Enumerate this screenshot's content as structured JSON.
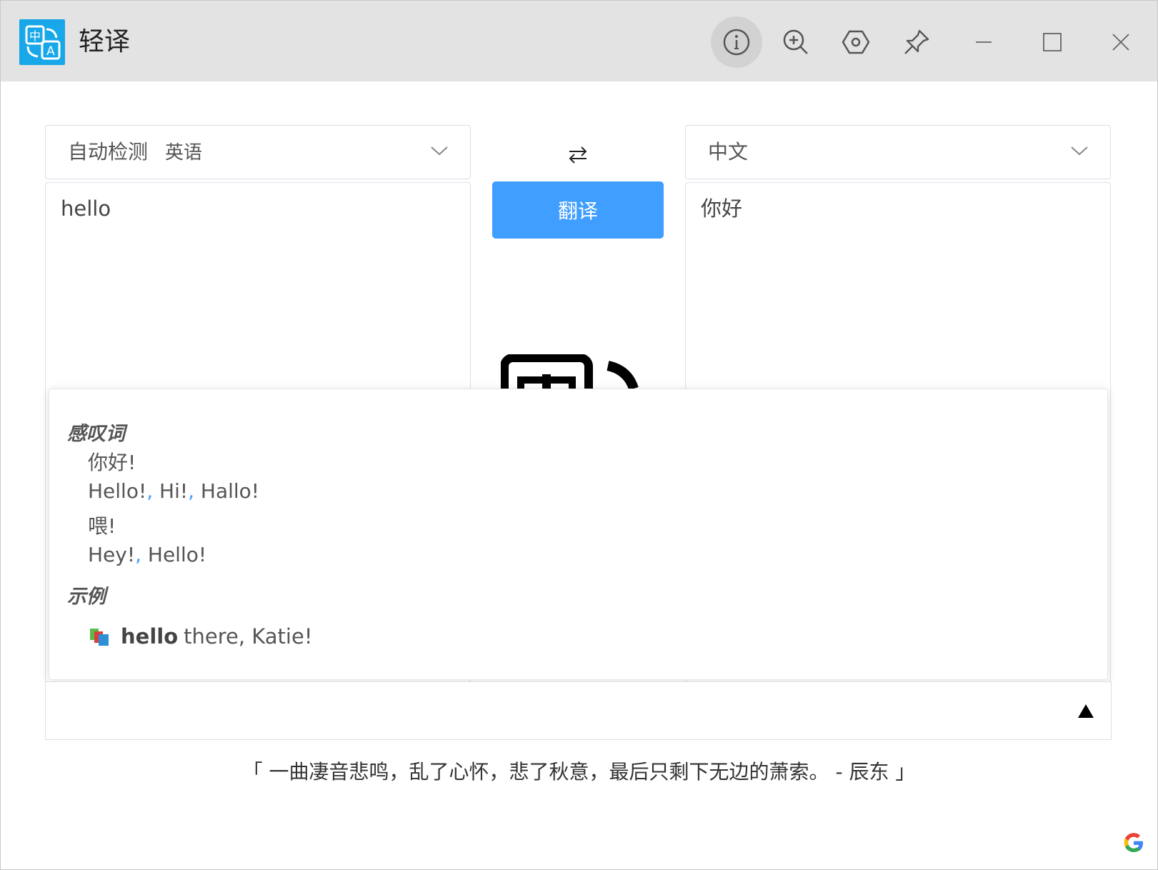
{
  "app": {
    "title": "轻译"
  },
  "toolbar": {
    "icons": [
      "info-icon",
      "zoom-in-icon",
      "settings-icon",
      "pin-icon"
    ],
    "window_controls": [
      "minimize-icon",
      "maximize-icon",
      "close-icon"
    ]
  },
  "source": {
    "language": "自动检测",
    "detected": "英语",
    "text": "hello"
  },
  "target": {
    "language": "中文",
    "text": "你好"
  },
  "swap_glyph": "⇄",
  "translate_label": "翻译",
  "dictionary": {
    "part_of_speech": "感叹词",
    "entries": [
      {
        "meaning": "你好!",
        "synonyms": [
          "Hello!",
          "Hi!",
          "Hallo!"
        ]
      },
      {
        "meaning": "喂!",
        "synonyms": [
          "Hey!",
          "Hello!"
        ]
      }
    ],
    "examples_heading": "示例",
    "example": {
      "bold": "hello",
      "rest": "there, Katie!"
    }
  },
  "collapse_glyph": "▲",
  "quote": "「 一曲凄音悲鸣，乱了心怀，悲了秋意，最后只剩下无边的萧索。 - 辰东 」",
  "colors": {
    "accent": "#409eff",
    "logo": "#18a7e8",
    "titlebar": "#e3e3e3"
  }
}
